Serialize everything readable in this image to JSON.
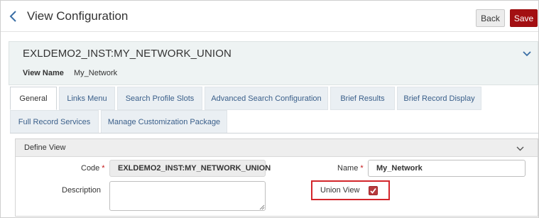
{
  "header": {
    "title": "View Configuration",
    "back_button": "Back",
    "save_button": "Save"
  },
  "record": {
    "title": "EXLDEMO2_INST:MY_NETWORK_UNION",
    "view_name_label": "View Name",
    "view_name_value": "My_Network"
  },
  "tabs": [
    {
      "label": "General",
      "active": true
    },
    {
      "label": "Links Menu"
    },
    {
      "label": "Search Profile Slots"
    },
    {
      "label": "Advanced Search Configuration"
    },
    {
      "label": "Brief Results"
    },
    {
      "label": "Brief Record Display"
    },
    {
      "label": "Full Record Services"
    },
    {
      "label": "Manage Customization Package"
    }
  ],
  "section": {
    "title": "Define View",
    "code_label": "Code",
    "code_value": "EXLDEMO2_INST:MY_NETWORK_UNION",
    "name_label": "Name",
    "name_value": "My_Network",
    "description_label": "Description",
    "description_value": "",
    "union_view_label": "Union View",
    "union_view_checked": true,
    "required_marker": "*"
  },
  "colors": {
    "save_bg": "#a30f12",
    "tab_text": "#3a5f8a",
    "record_bg": "#eef3f3",
    "highlight_frame": "#d3262b",
    "required": "#c31416"
  },
  "icons": {
    "back": "chevron-left-icon",
    "record_toggle": "chevron-down-icon",
    "section_toggle": "chevron-down-icon",
    "checkbox": "checkmark-icon",
    "resize": "resize-grip-icon"
  }
}
